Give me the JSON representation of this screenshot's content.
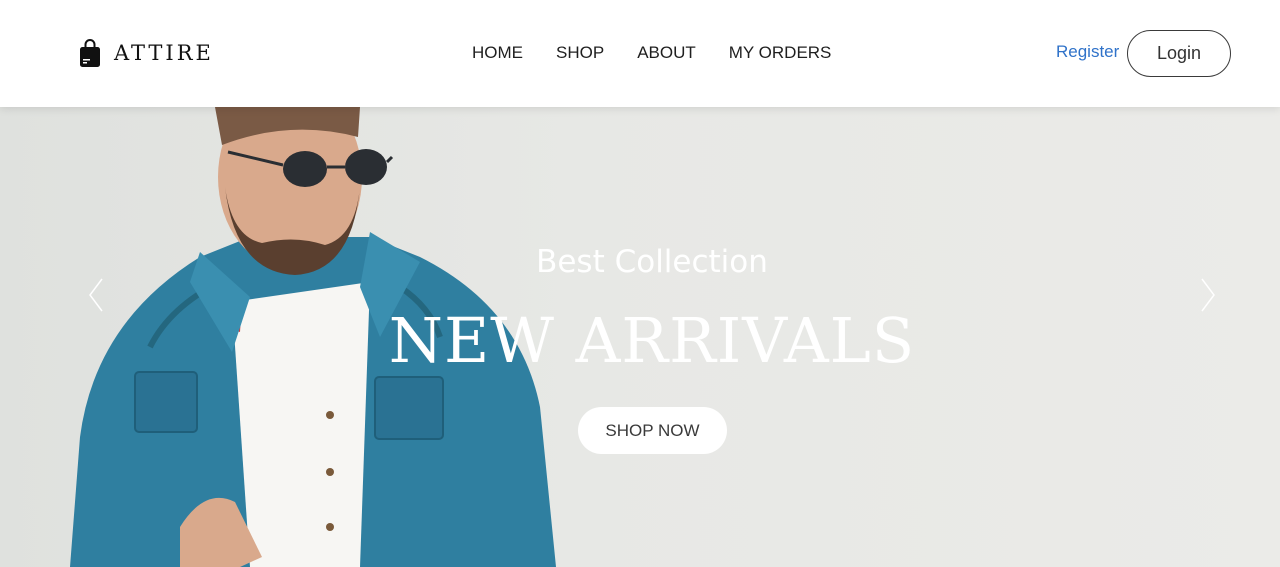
{
  "header": {
    "brand": {
      "name": "ATTIRE",
      "icon": "shopping-bag-icon"
    },
    "nav": [
      {
        "label": "HOME"
      },
      {
        "label": "SHOP"
      },
      {
        "label": "ABOUT"
      },
      {
        "label": "MY ORDERS"
      }
    ],
    "register_label": "Register",
    "login_label": "Login"
  },
  "hero": {
    "subtitle": "Best Collection",
    "title": "NEW ARRIVALS",
    "cta_label": "SHOP NOW",
    "prev_icon": "chevron-left-icon",
    "next_icon": "chevron-right-icon"
  },
  "colors": {
    "link_blue": "#2f72c9",
    "text_dark": "#1f1f1f",
    "hero_background": "#e6e7e4",
    "hero_text": "#ffffff"
  }
}
